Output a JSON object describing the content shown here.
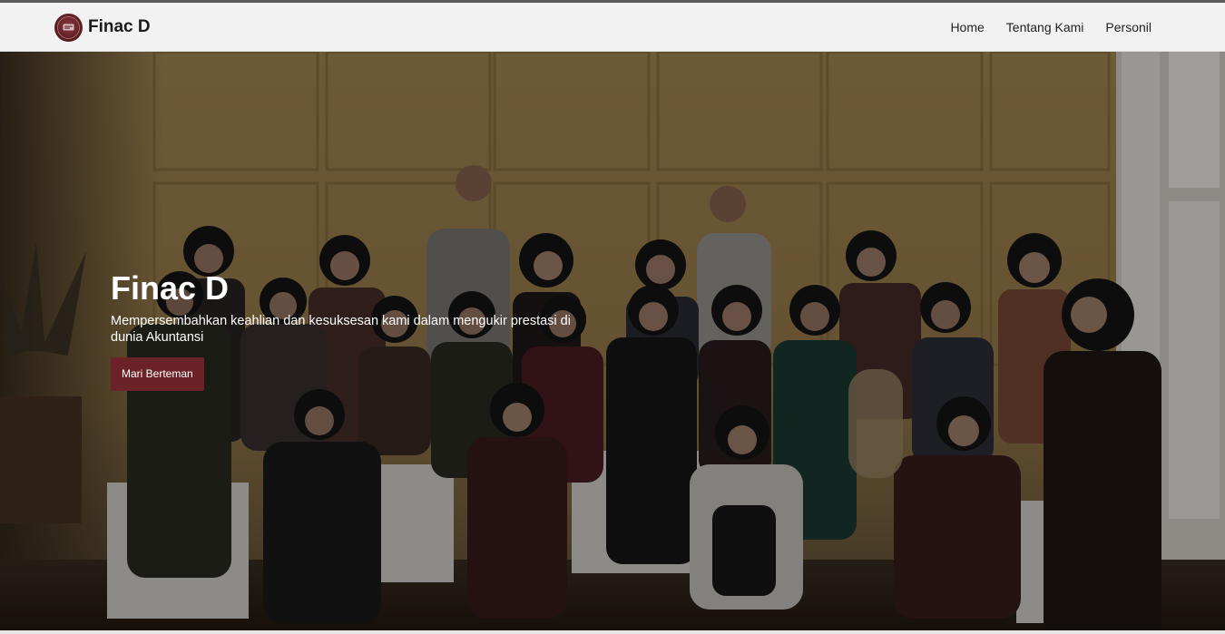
{
  "brand": {
    "name": "Finac D",
    "logo_icon": "emblem-icon",
    "logo_color": "#6b2328"
  },
  "nav": {
    "items": [
      {
        "label": "Home"
      },
      {
        "label": "Tentang Kami"
      },
      {
        "label": "Personil"
      }
    ]
  },
  "hero": {
    "title": "Finac D",
    "subtitle": "Mempersembahkan keahlian dan kesuksesan kami dalam mengukir prestasi di dunia Akuntansi",
    "button_label": "Mari Berteman",
    "button_color": "#6b2328",
    "image": "group-photo"
  }
}
